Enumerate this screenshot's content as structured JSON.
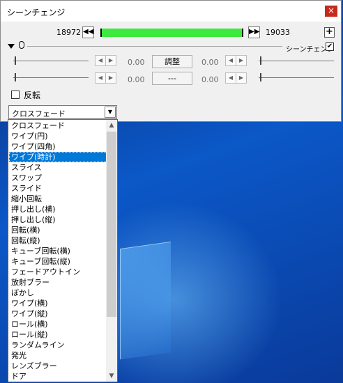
{
  "window": {
    "title": "シーンチェンジ",
    "close": "×"
  },
  "frames": {
    "start": "18972",
    "end": "19033",
    "prev_icon": "skip-back-icon",
    "next_icon": "skip-forward-icon",
    "plus": "+"
  },
  "header": {
    "scene_change_label": "シーンチェンジ",
    "scene_change_checked": true
  },
  "sliders": {
    "row1": {
      "left_value": "0.00",
      "button": "調整",
      "right_value": "0.00"
    },
    "row2": {
      "left_value": "0.00",
      "button": "---",
      "right_value": "0.00"
    }
  },
  "reverse": {
    "label": "反転",
    "checked": false
  },
  "combo": {
    "selected": "クロスフェード"
  },
  "dropdown": {
    "items": [
      "クロスフェード",
      "ワイプ(円)",
      "ワイプ(四角)",
      "ワイプ(時計)",
      "スライス",
      "スワップ",
      "スライド",
      "縮小回転",
      "押し出し(横)",
      "押し出し(縦)",
      "回転(横)",
      "回転(縦)",
      "キューブ回転(横)",
      "キューブ回転(縦)",
      "フェードアウトイン",
      "放射ブラー",
      "ぼかし",
      "ワイプ(横)",
      "ワイプ(縦)",
      "ロール(横)",
      "ロール(縦)",
      "ランダムライン",
      "発光",
      "レンズブラー",
      "ドア"
    ],
    "highlighted": "ワイプ(時計)"
  },
  "colors": {
    "timeline": "#3de93d",
    "highlight": "#0078d7",
    "close": "#c42b1c"
  }
}
